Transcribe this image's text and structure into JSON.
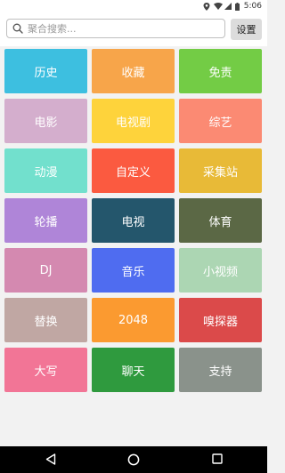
{
  "status_bar": {
    "time": "5:06",
    "icons": [
      "location-icon",
      "wifi-icon",
      "signal-icon",
      "battery-icon"
    ]
  },
  "search": {
    "placeholder": "聚合搜索...",
    "value": "",
    "icon": "search-icon"
  },
  "settings": {
    "label": "设置"
  },
  "tiles": [
    {
      "name": "tile-history",
      "label": "历史",
      "color": "#3dbfe0"
    },
    {
      "name": "tile-favorites",
      "label": "收藏",
      "color": "#f7a54a"
    },
    {
      "name": "tile-disclaimer",
      "label": "免责",
      "color": "#73cc45"
    },
    {
      "name": "tile-movies",
      "label": "电影",
      "color": "#d4aecd"
    },
    {
      "name": "tile-tv-series",
      "label": "电视剧",
      "color": "#fed33b"
    },
    {
      "name": "tile-variety",
      "label": "综艺",
      "color": "#fb8a73"
    },
    {
      "name": "tile-anime",
      "label": "动漫",
      "color": "#72e0cd"
    },
    {
      "name": "tile-custom",
      "label": "自定义",
      "color": "#fb5a40"
    },
    {
      "name": "tile-collection-site",
      "label": "采集站",
      "color": "#e8ba37"
    },
    {
      "name": "tile-carousel",
      "label": "轮播",
      "color": "#af85d8"
    },
    {
      "name": "tile-tv",
      "label": "电视",
      "color": "#24566c"
    },
    {
      "name": "tile-sports",
      "label": "体育",
      "color": "#5b6845"
    },
    {
      "name": "tile-dj",
      "label": "DJ",
      "color": "#d489b0"
    },
    {
      "name": "tile-music",
      "label": "音乐",
      "color": "#4f6cf0"
    },
    {
      "name": "tile-short-video",
      "label": "小视频",
      "color": "#acd6b3"
    },
    {
      "name": "tile-replace",
      "label": "替换",
      "color": "#c0a7a3"
    },
    {
      "name": "tile-2048",
      "label": "2048",
      "color": "#fb9a30"
    },
    {
      "name": "tile-sniffer",
      "label": "嗅探器",
      "color": "#db4a4a"
    },
    {
      "name": "tile-uppercase",
      "label": "大写",
      "color": "#f27596"
    },
    {
      "name": "tile-chat",
      "label": "聊天",
      "color": "#2f9a3e"
    },
    {
      "name": "tile-support",
      "label": "支持",
      "color": "#8a928b"
    }
  ],
  "nav_bar": {
    "icons": [
      "back-icon",
      "home-icon",
      "recents-icon"
    ]
  }
}
